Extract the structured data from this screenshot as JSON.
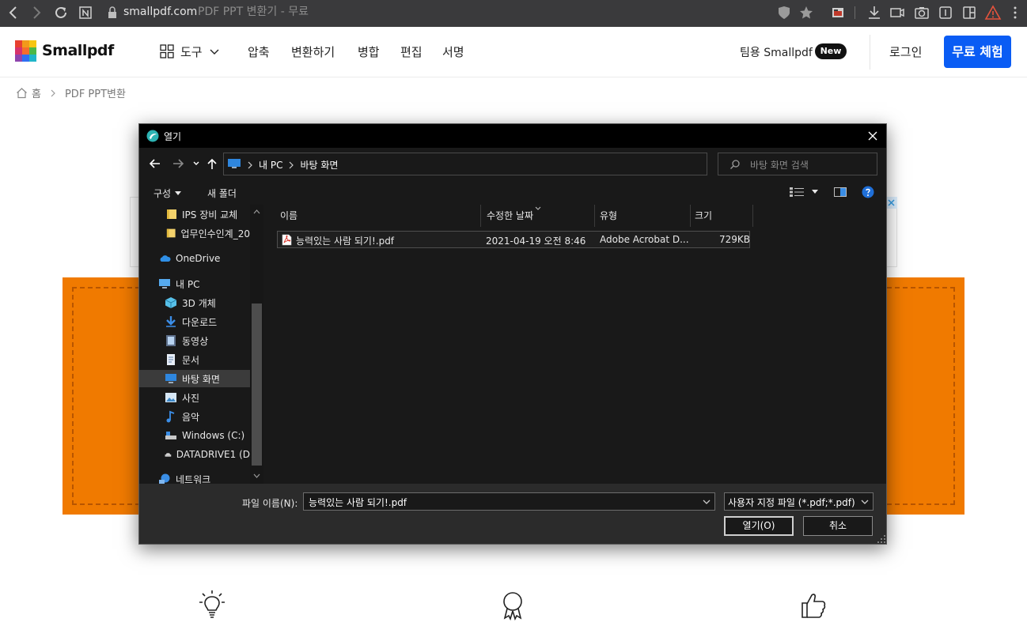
{
  "browser": {
    "address_domain": "smallpdf.com",
    "tab_title": "PDF PPT 변환기 - 무료"
  },
  "header": {
    "logo_text": "Smallpdf",
    "tools_label": "도구",
    "nav": [
      "압축",
      "변환하기",
      "병합",
      "편집",
      "서명"
    ],
    "team_label": "팀용 Smallpdf",
    "new_badge": "New",
    "login_label": "로그인",
    "trial_label": "무료 체험",
    "accent_color": "#0a5cf4"
  },
  "breadcrumb": {
    "home": "홈",
    "current": "PDF PPT변환"
  },
  "drop_zone": {
    "color": "#f07a00"
  },
  "dialog": {
    "title": "열기",
    "path": [
      "내 PC",
      "바탕 화면"
    ],
    "search_placeholder": "바탕 화면 검색",
    "organize_label": "구성",
    "new_folder_label": "새 폴더",
    "nav_items": [
      {
        "label": "IPS 장비 교체",
        "icon": "folder-icon"
      },
      {
        "label": "업무인수인계_20",
        "icon": "folder-icon"
      },
      {
        "label": "OneDrive",
        "icon": "cloud-icon"
      },
      {
        "label": "내 PC",
        "icon": "computer-icon"
      },
      {
        "label": "3D 개체",
        "icon": "cube-icon"
      },
      {
        "label": "다운로드",
        "icon": "download-icon"
      },
      {
        "label": "동영상",
        "icon": "video-icon"
      },
      {
        "label": "문서",
        "icon": "document-icon"
      },
      {
        "label": "바탕 화면",
        "icon": "desktop-icon"
      },
      {
        "label": "사진",
        "icon": "picture-icon"
      },
      {
        "label": "음악",
        "icon": "music-icon"
      },
      {
        "label": "Windows  (C:)",
        "icon": "drive-icon"
      },
      {
        "label": "DATADRIVE1 (D",
        "icon": "drive-icon"
      },
      {
        "label": "네트워크",
        "icon": "network-icon"
      }
    ],
    "selected_nav": "바탕 화면",
    "columns": [
      "이름",
      "수정한 날짜",
      "유형",
      "크기"
    ],
    "files": [
      {
        "name": "능력있는 사람 되기!.pdf",
        "modified": "2021-04-19 오전 8:46",
        "type": "Adobe Acrobat D...",
        "size": "729KB"
      }
    ],
    "filename_label": "파일 이름(N):",
    "filename_value": "능력있는 사람 되기!.pdf",
    "filetype_value": "사용자 지정 파일 (*.pdf;*.pdf)",
    "open_label": "열기(O)",
    "cancel_label": "취소"
  }
}
